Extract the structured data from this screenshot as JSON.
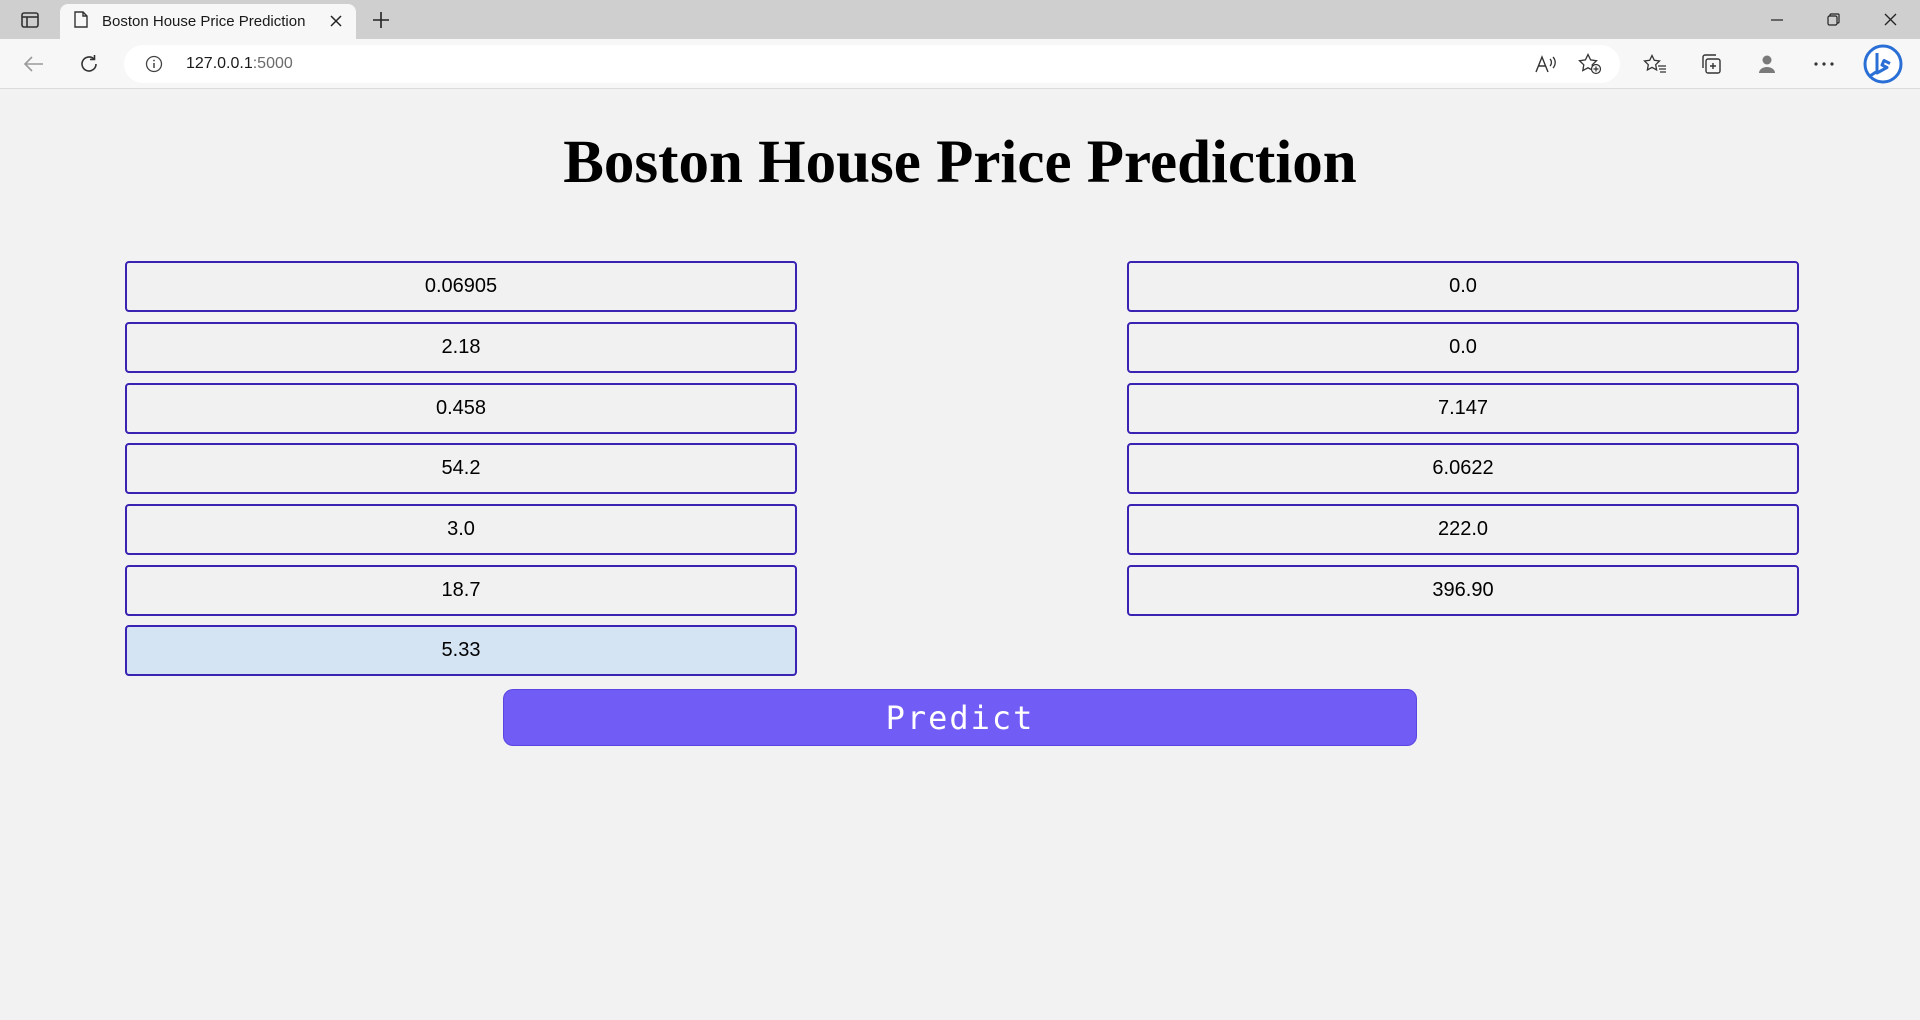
{
  "browser": {
    "tab_title": "Boston House Price Prediction",
    "url_host": "127.0.0.1",
    "url_port": ":5000"
  },
  "page": {
    "title": "Boston House Price Prediction",
    "left_fields": [
      "0.06905",
      "2.18",
      "0.458",
      "54.2",
      "3.0",
      "18.7",
      "5.33"
    ],
    "right_fields": [
      "0.0",
      "0.0",
      "7.147",
      "6.0622",
      "222.0",
      "396.90"
    ],
    "predict_label": "Predict"
  },
  "colors": {
    "field_border": "#3a23b3",
    "button_bg": "#715cf6",
    "focused_field_bg": "#d4e4f3"
  }
}
